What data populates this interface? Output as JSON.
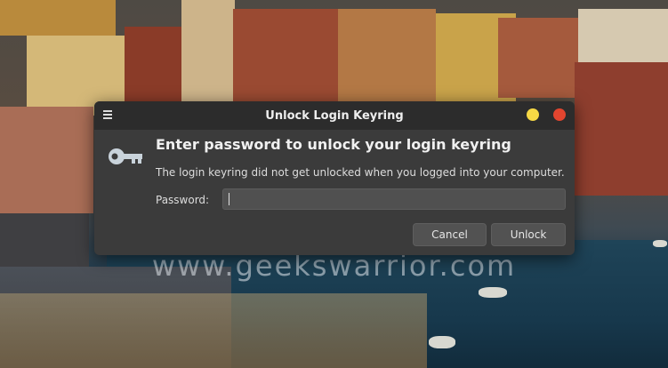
{
  "window": {
    "title": "Unlock Login Keyring"
  },
  "dialog": {
    "heading": "Enter password to unlock your login keyring",
    "description": "The login keyring did not get unlocked when you logged into your computer.",
    "password_label": "Password:",
    "password_value": "",
    "cancel_label": "Cancel",
    "unlock_label": "Unlock"
  },
  "icons": {
    "menu": "hamburger-menu-icon",
    "key": "key-icon",
    "minimize": "minimize-icon",
    "close": "close-icon"
  },
  "colors": {
    "dialog_bg": "#3b3b3b",
    "titlebar_bg": "#2c2c2c",
    "minimize": "#f6d845",
    "close": "#e2452f",
    "key": "#c9d3db"
  },
  "watermark": "www.geekswarrior.com"
}
